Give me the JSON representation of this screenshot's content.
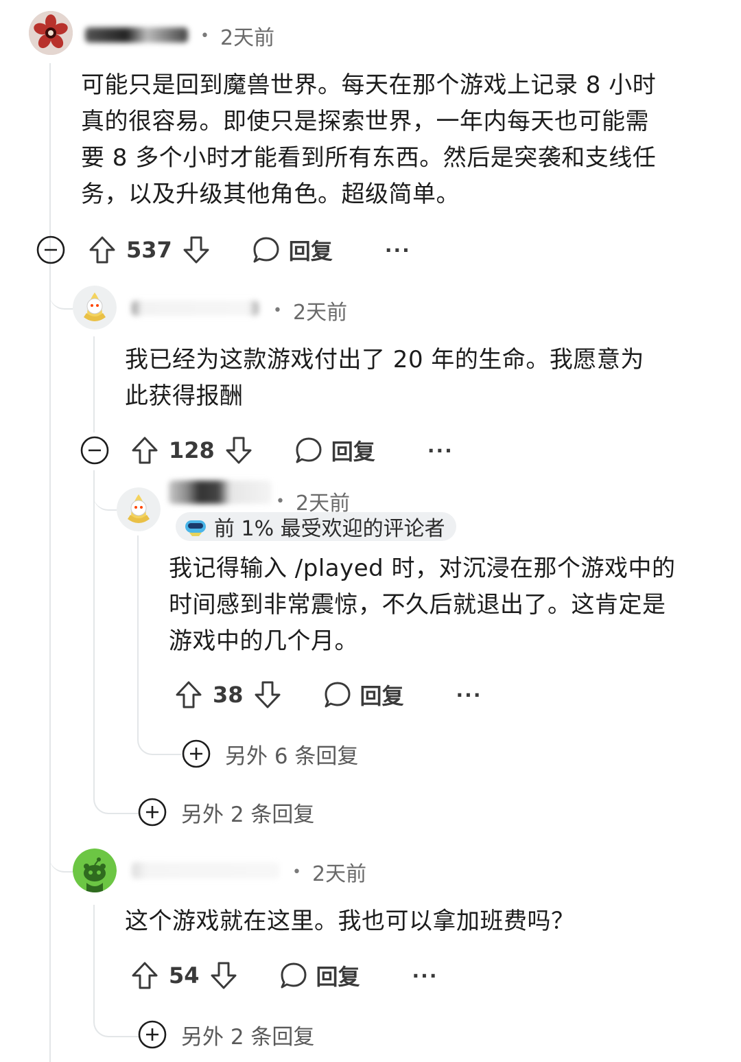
{
  "comments": [
    {
      "time": "2天前",
      "body_lines": [
        "可能只是回到魔兽世界。每天在那个游戏上记录 8 小时",
        "真的很容易。即使只是探索世界，一年内每天也可能需",
        "要 8 多个小时才能看到所有东西。然后是突袭和支线任",
        "务，以及升级其他角色。超级简单。"
      ],
      "score": "537",
      "reply_label": "回复",
      "more_label": "···"
    },
    {
      "time": "2天前",
      "body_lines": [
        "我已经为这款游戏付出了 20 年的生命。我愿意为",
        "此获得报酬"
      ],
      "score": "128",
      "reply_label": "回复",
      "more_label": "···"
    },
    {
      "time": "2天前",
      "flair": "前 1% 最受欢迎的评论者",
      "body_lines": [
        "我记得输入 /played 时，对沉浸在那个游戏中的",
        "时间感到非常震惊，不久后就退出了。这肯定是",
        "游戏中的几个月。"
      ],
      "score": "38",
      "reply_label": "回复",
      "more_label": "···",
      "more_replies": "另外 6 条回复"
    },
    {
      "time": "2天前",
      "body_lines": [
        "这个游戏就在这里。我也可以拿加班费吗？"
      ],
      "score": "54",
      "reply_label": "回复",
      "more_label": "···",
      "more_replies": "另外 2 条回复"
    }
  ],
  "thread_more_replies": "另外 2 条回复",
  "icons": [
    "collapse-icon",
    "upvote-icon",
    "downvote-icon",
    "comment-icon",
    "expand-icon",
    "flair-icon"
  ],
  "colors": {
    "thread_line": "#e3e6e8",
    "text": "#1c1c1c",
    "muted": "#6a6a6a"
  }
}
